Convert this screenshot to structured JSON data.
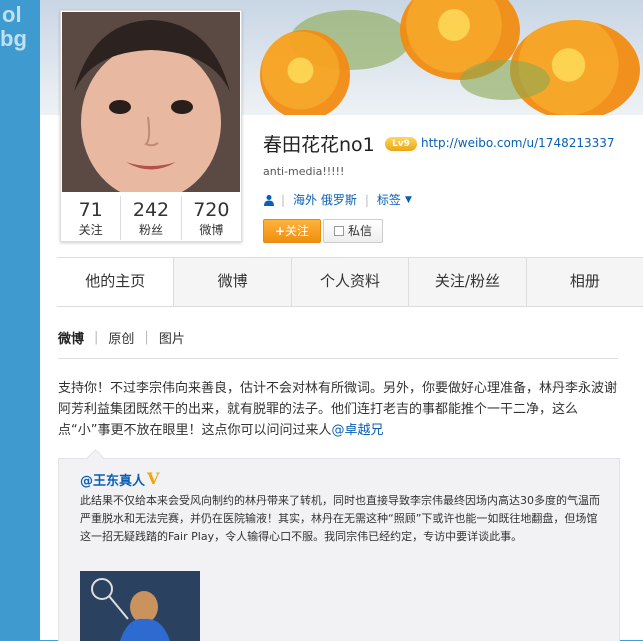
{
  "profile": {
    "name": "春田花花no1",
    "level_badge": "Lv9",
    "url": "http://weibo.com/u/1748213337",
    "bio": "anti-media!!!!!",
    "location": "海外 俄罗斯",
    "tags_label": "标签",
    "follow_label": "关注",
    "message_label": "私信"
  },
  "stats": [
    {
      "num": "71",
      "label": "关注"
    },
    {
      "num": "242",
      "label": "粉丝"
    },
    {
      "num": "720",
      "label": "微博"
    }
  ],
  "tabs": [
    "他的主页",
    "微博",
    "个人资料",
    "关注/粉丝",
    "相册"
  ],
  "subtabs": [
    "微博",
    "原创",
    "图片"
  ],
  "post": {
    "text": "支持你！不过李宗伟向来善良，估计不会对林有所微词。另外，你要做好心理准备，林丹李永波谢阿芳利益集团既然干的出来，就有脱罪的法子。他们连打老吉的事都能推个一干二净，这么点“小”事更不放在眼里！这点你可以问问过来人",
    "mention": "@卓越兄"
  },
  "quote": {
    "author": "@王东真人",
    "verified_badge": "V",
    "text": "此结果不仅给本来会受风向制约的林丹带来了转机，同时也直接导致李宗伟最终因场内高达30多度的气温而严重脱水和无法完赛，并仍在医院输液！其实，林丹在无需这种“照顾”下或许也能一如既往地翻盘，但场馆这一招无疑践踏的Fair Play，令人输得心口不服。我同宗伟已经约定，专访中要详谈此事。"
  },
  "colors": {
    "link": "#0a5fb4",
    "follow_button": "#f08f0f",
    "page_bg": "#3a9fd8"
  }
}
